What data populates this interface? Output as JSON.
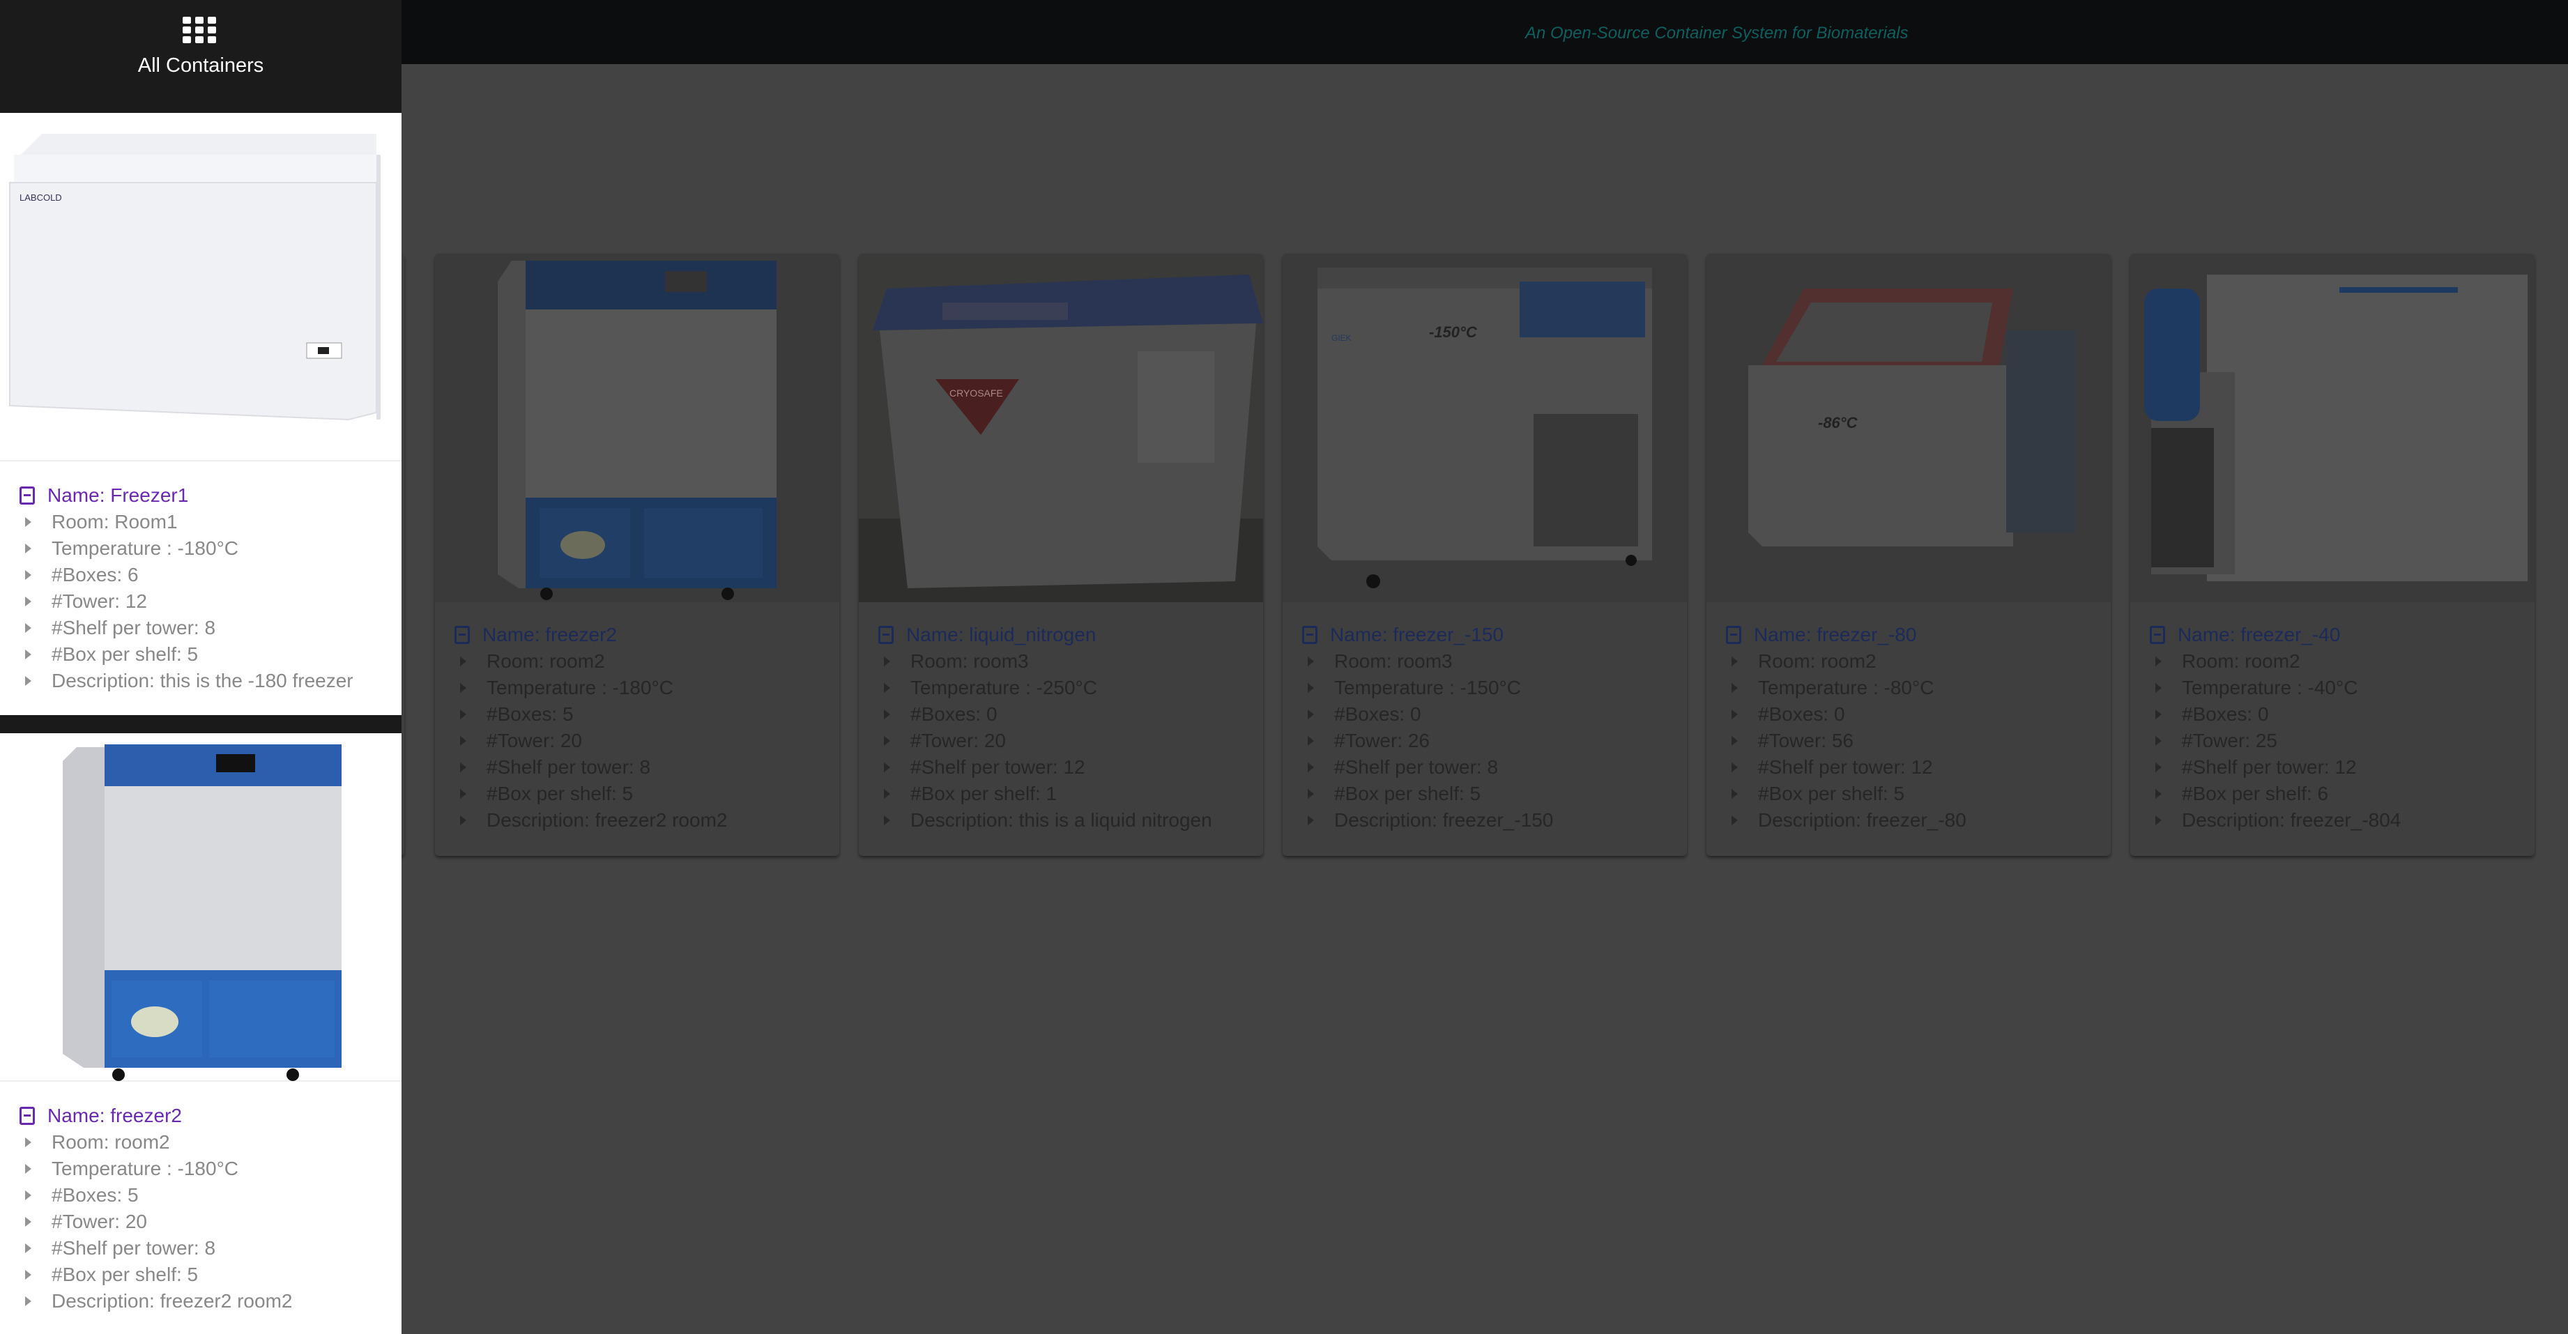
{
  "app": {
    "tagline": "An Open-Source Container System for Biomaterials"
  },
  "sidebar": {
    "icon": "grid-icon",
    "title": "All Containers",
    "cards": [
      {
        "name": "Name: Freezer1",
        "details": [
          "Room: Room1",
          "Temperature : -180°C",
          "#Boxes: 6",
          "#Tower: 12",
          "#Shelf per tower: 8",
          "#Box per shelf: 5",
          "Description: this is the -180 freezer"
        ]
      },
      {
        "name": "Name: freezer2",
        "details": [
          "Room: room2",
          "Temperature : -180°C",
          "#Boxes: 5",
          "#Tower: 20",
          "#Shelf per tower: 8",
          "#Box per shelf: 5",
          "Description: freezer2 room2"
        ]
      }
    ]
  },
  "cards": [
    {
      "name": "Name: freezer2",
      "details": [
        "Room: room2",
        "Temperature : -180°C",
        "#Boxes: 5",
        "#Tower: 20",
        "#Shelf per tower: 8",
        "#Box per shelf: 5",
        "Description: freezer2 room2"
      ]
    },
    {
      "name": "Name: liquid_nitrogen",
      "details": [
        "Room: room3",
        "Temperature : -250°C",
        "#Boxes: 0",
        "#Tower: 20",
        "#Shelf per tower: 12",
        "#Box per shelf: 1",
        "Description: this is a liquid nitrogen"
      ]
    },
    {
      "name": "Name: freezer_-150",
      "details": [
        "Room: room3",
        "Temperature : -150°C",
        "#Boxes: 0",
        "#Tower: 26",
        "#Shelf per tower: 8",
        "#Box per shelf: 5",
        "Description: freezer_-150"
      ]
    },
    {
      "name": "Name: freezer_-80",
      "details": [
        "Room: room2",
        "Temperature : -80°C",
        "#Boxes: 0",
        "#Tower: 56",
        "#Shelf per tower: 12",
        "#Box per shelf: 5",
        "Description: freezer_-80"
      ]
    },
    {
      "name": "Name: freezer_-40",
      "details": [
        "Room: room2",
        "Temperature : -40°C",
        "#Boxes: 0",
        "#Tower: 25",
        "#Shelf per tower: 12",
        "#Box per shelf: 6",
        "Description: freezer_-804"
      ]
    }
  ],
  "image_labels": {
    "freezer1_brand": "LABCOLD",
    "liquid_nitrogen_brand": "CRYOSAFE",
    "freezer150_temp": "-150°C",
    "freezer150_brand": "GIEK",
    "freezer80_temp": "-86°C"
  }
}
